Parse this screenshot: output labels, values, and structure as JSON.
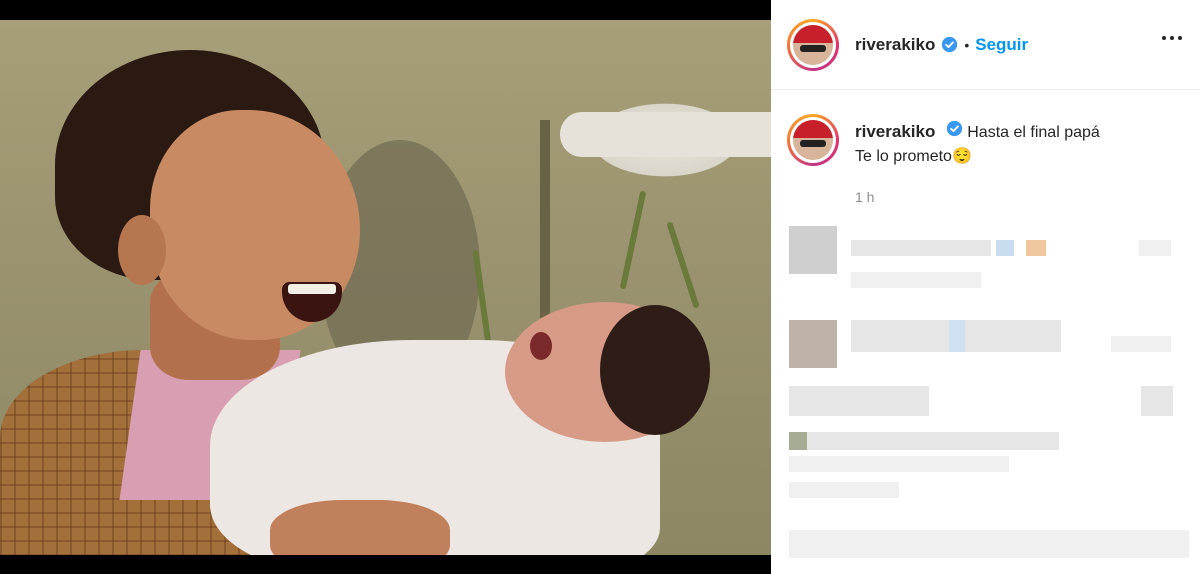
{
  "post": {
    "username": "riverakiko",
    "follow_label": "Seguir",
    "caption_line1": "Hasta el final papá",
    "caption_line2": "Te lo prometo😌",
    "timestamp": "1 h"
  },
  "icons": {
    "verified": "verified-badge-icon",
    "more": "more-options-icon"
  },
  "colors": {
    "follow": "#0095f6",
    "verified": "#3897f0",
    "text": "#262626",
    "muted": "#8e8e8e"
  }
}
